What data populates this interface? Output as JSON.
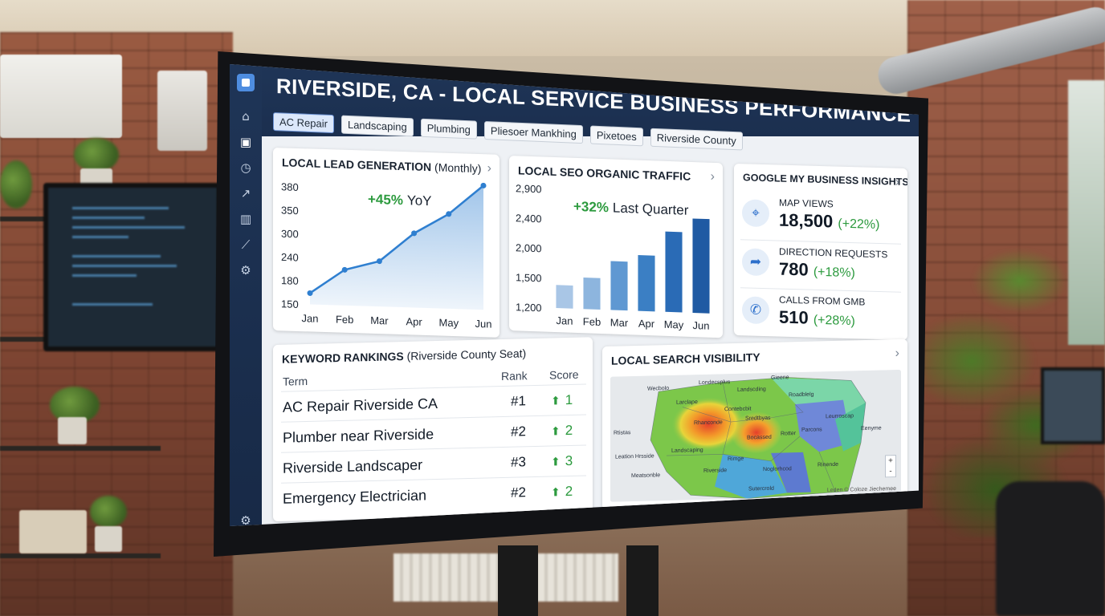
{
  "dashboard": {
    "title": "RIVERSIDE, CA - LOCAL SERVICE BUSINESS PERFORMANCE",
    "tabs": [
      "AC Repair",
      "Landscaping",
      "Plumbing",
      "Pliesoer Mankhing",
      "Pixetoes",
      "Riverside County"
    ],
    "active_tab": "AC Repair"
  },
  "sidebar": {
    "icons": [
      "logo-icon",
      "home-icon",
      "dashboard-icon",
      "clock-icon",
      "trend-icon",
      "bar-chart-icon",
      "line-chart-icon",
      "settings-icon",
      "settings-icon"
    ]
  },
  "lead_generation": {
    "title_bold": "LOCAL LEAD GENERATION",
    "title_thin": "(Monthly)",
    "annotation_value": "+45%",
    "annotation_label": "YoY"
  },
  "seo_traffic": {
    "title": "LOCAL SEO ORGANIC TRAFFIC",
    "annotation_value": "+32%",
    "annotation_label": "Last Quarter"
  },
  "gmb": {
    "title": "GOOGLE MY BUSINESS INSIGHTS",
    "metrics": [
      {
        "label": "MAP VIEWS",
        "value": "18,500",
        "change": "(+22%)",
        "icon": "map-pin-icon"
      },
      {
        "label": "DIRECTION REQUESTS",
        "value": "780",
        "change": "(+18%)",
        "icon": "directions-icon"
      },
      {
        "label": "CALLS FROM GMB",
        "value": "510",
        "change": "(+28%)",
        "icon": "phone-icon"
      }
    ]
  },
  "keywords": {
    "title_bold": "KEYWORD RANKINGS",
    "title_thin": "(Riverside County Seat)",
    "headers": {
      "term": "Term",
      "rank": "Rank",
      "score": "Score"
    },
    "rows": [
      {
        "term": "AC Repair Riverside CA",
        "rank": "#1",
        "score": "1"
      },
      {
        "term": "Plumber near Riverside",
        "rank": "#2",
        "score": "2"
      },
      {
        "term": "Riverside Landscaper",
        "rank": "#3",
        "score": "3"
      },
      {
        "term": "Emergency Electrician",
        "rank": "#2",
        "score": "2"
      }
    ]
  },
  "map": {
    "title": "LOCAL SEARCH VISIBILITY",
    "zoom_in": "+",
    "zoom_out": "-",
    "attribution": "Leden © Coloze Jiechemee",
    "labels": [
      "Londecsplus",
      "Gieene",
      "Wecbolo",
      "Landscding",
      "Roadblelg",
      "Larclape",
      "Contebcbit",
      "Rhanconde",
      "Sredtbyas",
      "Rtistas",
      "Landscaping",
      "Bocassed",
      "Rotter",
      "Parcons",
      "Leurroscap",
      "Riverside",
      "Rimge",
      "Noglorhcod",
      "Rinende",
      "Leation Hrsside",
      "Meatsonble",
      "Sutercrold",
      "Eenyme"
    ]
  },
  "chart_data": [
    {
      "type": "area",
      "title": "LOCAL LEAD GENERATION (Monthly)",
      "x": [
        "Jan",
        "Feb",
        "Mar",
        "Apr",
        "May",
        "Jun"
      ],
      "y_ticks": [
        380,
        350,
        300,
        240,
        180,
        150
      ],
      "values": [
        172,
        220,
        239,
        296,
        336,
        394
      ],
      "ylim": [
        150,
        380
      ],
      "annotation": "+45% YoY",
      "color": "#2f7fd0",
      "grid": false
    },
    {
      "type": "bar",
      "title": "LOCAL SEO ORGANIC TRAFFIC",
      "categories": [
        "Jan",
        "Feb",
        "Mar",
        "Apr",
        "May",
        "Jun"
      ],
      "y_ticks": [
        "2,900",
        "2,400",
        "2,000",
        "1,500",
        "1,200"
      ],
      "values": [
        1530,
        1650,
        1900,
        2000,
        2350,
        2550
      ],
      "ylim": [
        1200,
        2900
      ],
      "annotation": "+32% Last Quarter",
      "colors": [
        "#a9c6e6",
        "#8db5de",
        "#5f98d2",
        "#3b7fc4",
        "#2a6bb6",
        "#1f5aa3"
      ],
      "grid": false
    }
  ]
}
